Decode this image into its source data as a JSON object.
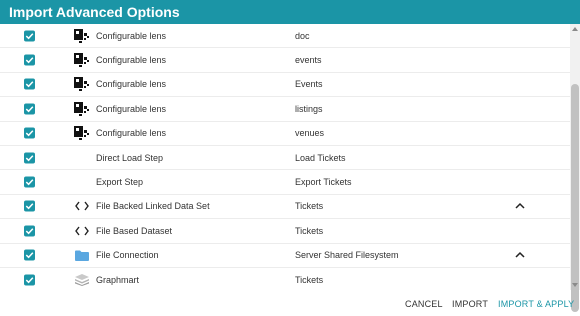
{
  "dialog": {
    "title": "Import Advanced Options"
  },
  "colors": {
    "accent": "#1b95a6",
    "header_text": "#ffffff",
    "folder": "#5aa7e0"
  },
  "rows": [
    {
      "checked": true,
      "icon": "configurable-lens-icon",
      "type": "Configurable lens",
      "name": "doc",
      "expand": null
    },
    {
      "checked": true,
      "icon": "configurable-lens-icon",
      "type": "Configurable lens",
      "name": "events",
      "expand": null
    },
    {
      "checked": true,
      "icon": "configurable-lens-icon",
      "type": "Configurable lens",
      "name": "Events",
      "expand": null
    },
    {
      "checked": true,
      "icon": "configurable-lens-icon",
      "type": "Configurable lens",
      "name": "listings",
      "expand": null
    },
    {
      "checked": true,
      "icon": "configurable-lens-icon",
      "type": "Configurable lens",
      "name": "venues",
      "expand": null
    },
    {
      "checked": true,
      "icon": null,
      "type": "Direct Load Step",
      "name": "Load Tickets",
      "expand": null
    },
    {
      "checked": true,
      "icon": null,
      "type": "Export Step",
      "name": "Export Tickets",
      "expand": null
    },
    {
      "checked": true,
      "icon": "code-brackets-icon",
      "type": "File Backed Linked Data Set",
      "name": "Tickets",
      "expand": "chevron-up-icon"
    },
    {
      "checked": true,
      "icon": "code-brackets-icon",
      "type": "File Based Dataset",
      "name": "Tickets",
      "expand": null
    },
    {
      "checked": true,
      "icon": "folder-icon",
      "type": "File Connection",
      "name": "Server Shared Filesystem",
      "expand": "chevron-up-icon"
    },
    {
      "checked": true,
      "icon": "graphmart-icon",
      "type": "Graphmart",
      "name": "Tickets",
      "expand": null
    }
  ],
  "footer": {
    "cancel_label": "CANCEL",
    "import_label": "IMPORT",
    "apply_label": "IMPORT & APPLY"
  }
}
